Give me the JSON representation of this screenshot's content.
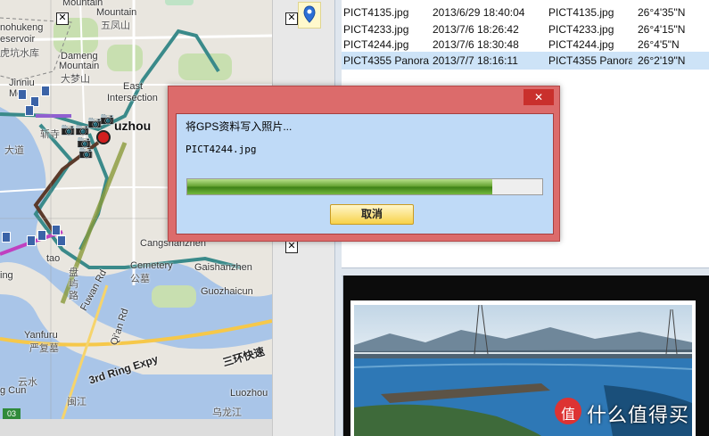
{
  "map": {
    "labels": {
      "tl1": "Mountain",
      "tl2": "Reservoir",
      "mtn": "Mountain",
      "wufeng": "五凤山",
      "nohukeng": "nohukeng",
      "eservoir": "eservoir",
      "hukeng": "虎坑水库",
      "damen": "Dameng",
      "damen2": "Mountain",
      "damen3": "大梦山",
      "jinniu": "Jinniu",
      "jinniu2": "Mo",
      "east": "East",
      "intersection": "Intersection",
      "fuzhou": "uzhou",
      "bridge": "斩寺",
      "daoyong": "大道",
      "cangshan": "Cangshanzhen",
      "cemetery": "Cemetery",
      "cemetery_cn": "公墓",
      "gaishan": "Gaishanzhen",
      "guozhai": "Guozhaicun",
      "panyu": "盘屿路",
      "fuwan": "Fuwan Rd",
      "qiaoan": "Qi'an Rd",
      "tao": "tao",
      "ing": "ing",
      "yanfu": "Yanfuru",
      "yanfu_cn": "严复墓",
      "ring": "3rd Ring Expy",
      "ring_cn": "三环快速",
      "gcun": "g Cun",
      "luozhou": "Luozhou",
      "minjiang": "闽江",
      "wulong": "乌龙江",
      "yunju": "云水",
      "route_num": "03"
    }
  },
  "photo_list": {
    "rows": [
      {
        "name": "PICT4135.jpg",
        "date": "2013/6/29 18:40:04",
        "file": "PICT4135.jpg",
        "lat": "26°4'35\"N"
      },
      {
        "name": "PICT4233.jpg",
        "date": "2013/7/6 18:26:42",
        "file": "PICT4233.jpg",
        "lat": "26°4'15\"N"
      },
      {
        "name": "PICT4244.jpg",
        "date": "2013/7/6 18:30:48",
        "file": "PICT4244.jpg",
        "lat": "26°4'5\"N"
      },
      {
        "name": "PICT4355 Panora",
        "date": "2013/7/7 18:16:11",
        "file": "PICT4355 Panora",
        "lat": "26°2'19\"N"
      }
    ],
    "selected_index": 3
  },
  "dialog": {
    "close_label": "✕",
    "message": "将GPS资料写入照片...",
    "current_file": "PICT4244.jpg",
    "progress": 0.86,
    "cancel_label": "取消"
  },
  "watermark": {
    "text": "什么值得买",
    "icon_glyph": "值"
  },
  "colors": {
    "dialog_frame": "#dc6b6b",
    "dialog_body": "#bfdaf7",
    "selected_row": "#cde3f7",
    "progress_fill": "#5e9e2a",
    "cancel_button": "#f7d24a"
  }
}
